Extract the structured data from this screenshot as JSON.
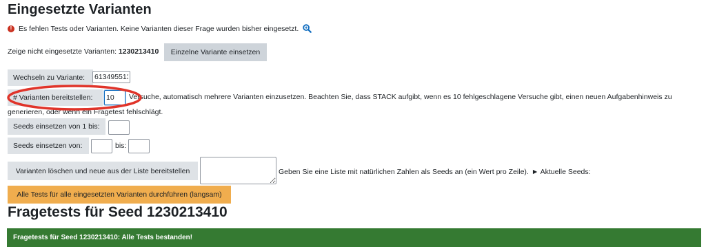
{
  "main_heading": "Eingesetzte Varianten",
  "warning": {
    "text": "Es fehlen Tests oder Varianten. Keine Varianten dieser Frage wurden bisher eingesetzt.",
    "icon": "exclamation-circle-icon",
    "help_icon": "magnifier-icon"
  },
  "not_deployed": {
    "text_prefix": "Zeige nicht eingesetzte Varianten: ",
    "seed": "1230213410",
    "button": "Einzelne Variante einsetzen"
  },
  "switch_variant": {
    "label": "Wechseln zu Variante:",
    "value": "613495513"
  },
  "deploy_many": {
    "label": "# Varianten bereitstellen:",
    "value": "10",
    "description_line1": "Versuche, automatisch mehrere Varianten einzusetzen. Beachten Sie, dass STACK aufgibt, wenn es 10 fehlgeschlagene Versuche gibt, einen neuen Aufgabenhinweis zu",
    "description_line2": "generieren, oder wenn ein Fragetest fehlschlägt."
  },
  "seeds_from_one": {
    "label": "Seeds einsetzen von 1 bis:",
    "value": ""
  },
  "seeds_range": {
    "label": "Seeds einsetzen von:",
    "from_value": "",
    "to_label": "bis:",
    "to_value": ""
  },
  "delete_redeploy": {
    "button": "Varianten löschen und neue aus der Liste bereitstellen",
    "textarea_value": "",
    "hint": "Geben Sie eine Liste mit natürlichen Zahlen als Seeds an (ein Wert pro Zeile).",
    "toggle_label": "► Aktuelle Seeds:"
  },
  "run_all_button": "Alle Tests für alle eingesetzten Varianten durchführen (langsam)",
  "tests_heading": "Fragetests für Seed 1230213410",
  "success_message": "Fragetests für Seed 1230213410: Alle Tests bestanden!",
  "colors": {
    "success": "#357a32",
    "warning_red": "#ca3120",
    "annotation_red": "#e0342a",
    "orange_button": "#f0ad4e"
  }
}
